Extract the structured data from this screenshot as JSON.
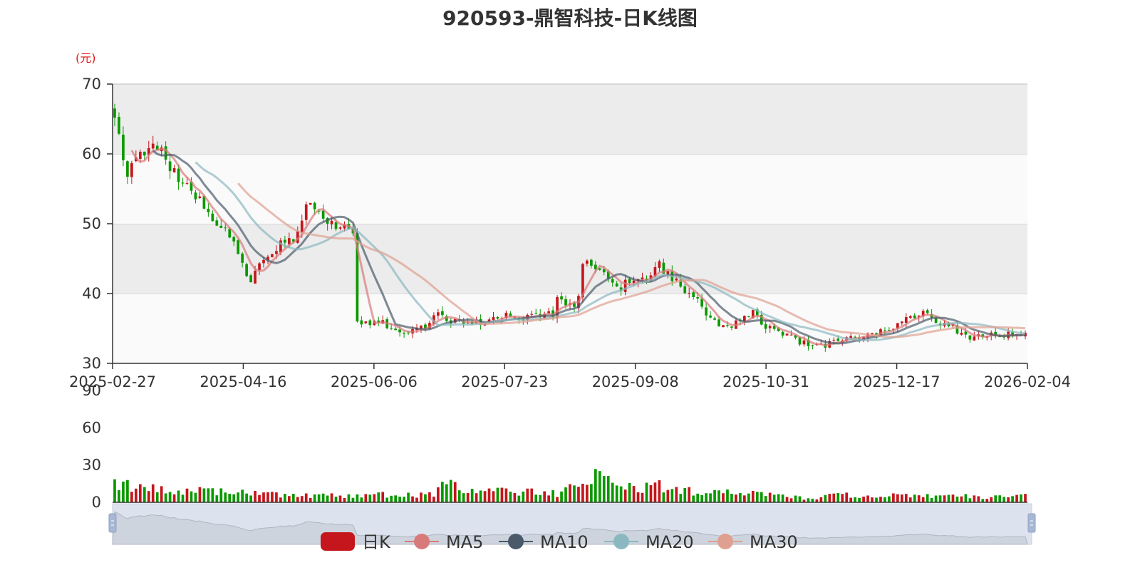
{
  "title": "920593-鼎智科技-日K线图",
  "unit": "(元)",
  "colors": {
    "up": "#c4161c",
    "down": "#0a9900",
    "ma5": "#d97a7a",
    "ma10": "#4a5a6a",
    "ma20": "#8bb8c0",
    "ma30": "#e0a090",
    "band_dark": "#ececec",
    "band_light": "#fafafa",
    "navigator_bg": "#dde3ee",
    "navigator_area": "#c3c9d4"
  },
  "chart_data": {
    "type": "candlestick",
    "price_axis": {
      "ylim": [
        30,
        70
      ],
      "ticks": [
        "70",
        "60",
        "50",
        "40",
        "30"
      ]
    },
    "volume_axis": {
      "ylim": [
        0,
        90
      ],
      "ticks": [
        "90",
        "60",
        "30",
        "0"
      ]
    },
    "x_ticks": [
      "2025-02-27",
      "2025-04-16",
      "2025-06-06",
      "2025-07-23",
      "2025-09-08",
      "2025-10-31",
      "2025-12-17",
      "2026-02-04"
    ],
    "price_path": [
      [
        0,
        65
      ],
      [
        3,
        57
      ],
      [
        6,
        60
      ],
      [
        10,
        61
      ],
      [
        13,
        58
      ],
      [
        16,
        56
      ],
      [
        19,
        54
      ],
      [
        21,
        52
      ],
      [
        24,
        50
      ],
      [
        27,
        48
      ],
      [
        30,
        44
      ],
      [
        32,
        42
      ],
      [
        34,
        45
      ],
      [
        37,
        45
      ],
      [
        39,
        47
      ],
      [
        42,
        48
      ],
      [
        45,
        53
      ],
      [
        48,
        52
      ],
      [
        51,
        50
      ],
      [
        54,
        50
      ],
      [
        56,
        48
      ],
      [
        57,
        35.5
      ],
      [
        60,
        36
      ],
      [
        64,
        35.5
      ],
      [
        68,
        34.5
      ],
      [
        72,
        35
      ],
      [
        76,
        37
      ],
      [
        80,
        36
      ],
      [
        84,
        35.5
      ],
      [
        88,
        36
      ],
      [
        92,
        37
      ],
      [
        96,
        36.5
      ],
      [
        100,
        37
      ],
      [
        103,
        37
      ],
      [
        104,
        39
      ],
      [
        107,
        38
      ],
      [
        109,
        39
      ],
      [
        110,
        44
      ],
      [
        113,
        44
      ],
      [
        116,
        42
      ],
      [
        119,
        41
      ],
      [
        122,
        42
      ],
      [
        125,
        42
      ],
      [
        128,
        44
      ],
      [
        130,
        43
      ],
      [
        133,
        41
      ],
      [
        136,
        40
      ],
      [
        138,
        38
      ],
      [
        140,
        36
      ],
      [
        143,
        35
      ],
      [
        146,
        36
      ],
      [
        150,
        37
      ],
      [
        154,
        35
      ],
      [
        158,
        34
      ],
      [
        162,
        33
      ],
      [
        164,
        32
      ],
      [
        166,
        32.5
      ],
      [
        170,
        33
      ],
      [
        174,
        34
      ],
      [
        178,
        34.5
      ],
      [
        182,
        35
      ],
      [
        186,
        37
      ],
      [
        190,
        37
      ],
      [
        194,
        36
      ],
      [
        197,
        35
      ],
      [
        200,
        34
      ],
      [
        203,
        34
      ],
      [
        206,
        34
      ],
      [
        210,
        34.2
      ],
      [
        214,
        34
      ]
    ],
    "volume_path": [
      [
        0,
        16
      ],
      [
        6,
        12
      ],
      [
        20,
        9
      ],
      [
        40,
        6
      ],
      [
        55,
        5
      ],
      [
        58,
        6
      ],
      [
        75,
        6
      ],
      [
        78,
        16
      ],
      [
        82,
        8
      ],
      [
        96,
        9
      ],
      [
        104,
        7
      ],
      [
        110,
        16
      ],
      [
        114,
        22
      ],
      [
        118,
        14
      ],
      [
        122,
        11
      ],
      [
        128,
        13
      ],
      [
        134,
        9
      ],
      [
        150,
        7
      ],
      [
        163,
        3
      ],
      [
        170,
        6
      ],
      [
        185,
        5
      ],
      [
        196,
        6
      ],
      [
        205,
        4
      ],
      [
        214,
        6
      ]
    ],
    "series": [
      {
        "name": "日K"
      },
      {
        "name": "MA5"
      },
      {
        "name": "MA10"
      },
      {
        "name": "MA20"
      },
      {
        "name": "MA30"
      }
    ]
  }
}
